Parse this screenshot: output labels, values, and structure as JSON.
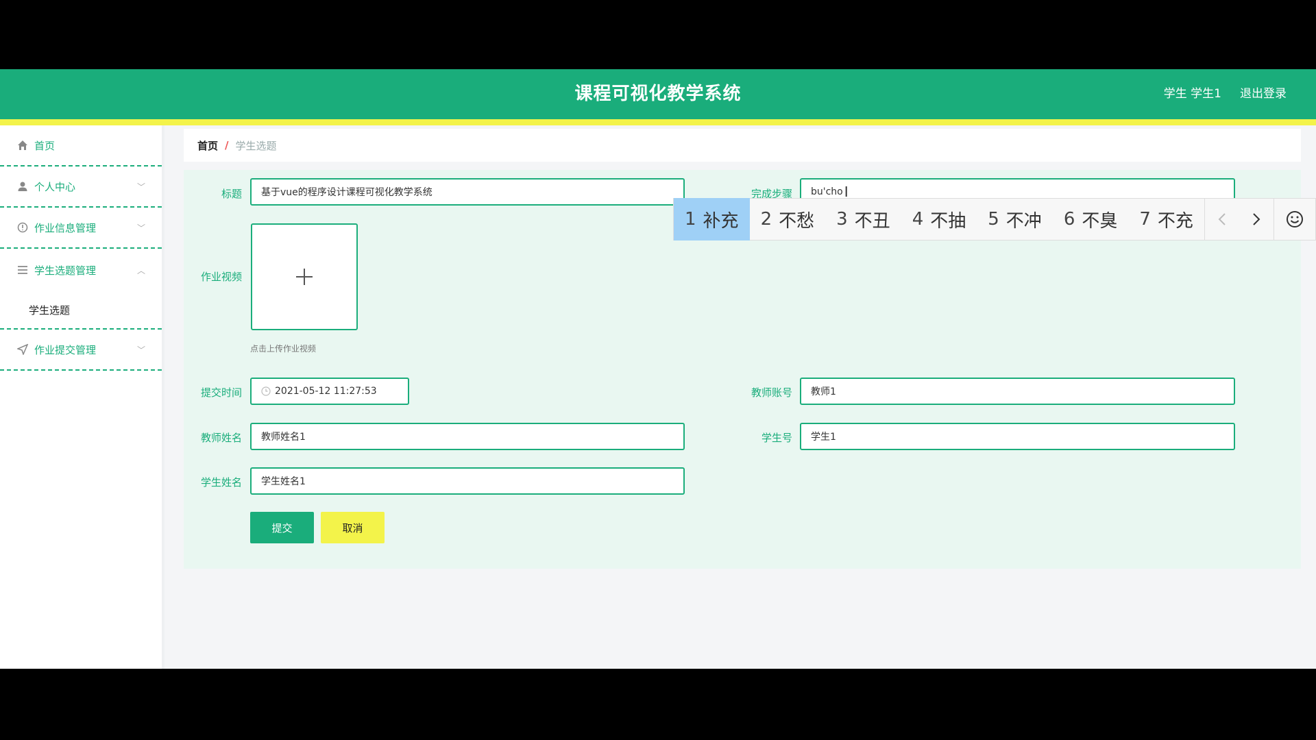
{
  "header": {
    "title": "课程可视化教学系统",
    "user": "学生 学生1",
    "logout": "退出登录"
  },
  "sidebar": {
    "items": [
      {
        "label": "首页",
        "icon": "home-icon"
      },
      {
        "label": "个人中心",
        "icon": "user-icon"
      },
      {
        "label": "作业信息管理",
        "icon": "info-icon"
      },
      {
        "label": "学生选题管理",
        "icon": "list-icon"
      },
      {
        "label": "作业提交管理",
        "icon": "send-icon"
      }
    ],
    "sub_item": "学生选题"
  },
  "breadcrumb": {
    "home": "首页",
    "separator": "/",
    "current": "学生选题"
  },
  "form": {
    "title_label": "标题",
    "title_value": "基于vue的程序设计课程可视化教学系统",
    "steps_label": "完成步骤",
    "steps_value": "bu'cho",
    "video_label": "作业视频",
    "upload_hint": "点击上传作业视频",
    "time_label": "提交时间",
    "time_value": "2021-05-12 11:27:53",
    "teacher_account_label": "教师账号",
    "teacher_account_value": "教师1",
    "teacher_name_label": "教师姓名",
    "teacher_name_value": "教师姓名1",
    "student_no_label": "学生号",
    "student_no_value": "学生1",
    "student_name_label": "学生姓名",
    "student_name_value": "学生姓名1",
    "submit": "提交",
    "cancel": "取消"
  },
  "ime": {
    "candidates": [
      {
        "num": "1",
        "text": "补充"
      },
      {
        "num": "2",
        "text": "不愁"
      },
      {
        "num": "3",
        "text": "不丑"
      },
      {
        "num": "4",
        "text": "不抽"
      },
      {
        "num": "5",
        "text": "不冲"
      },
      {
        "num": "6",
        "text": "不臭"
      },
      {
        "num": "7",
        "text": "不充"
      }
    ]
  },
  "colors": {
    "brand": "#1aad7b",
    "accent": "#f3f34a",
    "ime_selected": "#9fd0f6"
  }
}
